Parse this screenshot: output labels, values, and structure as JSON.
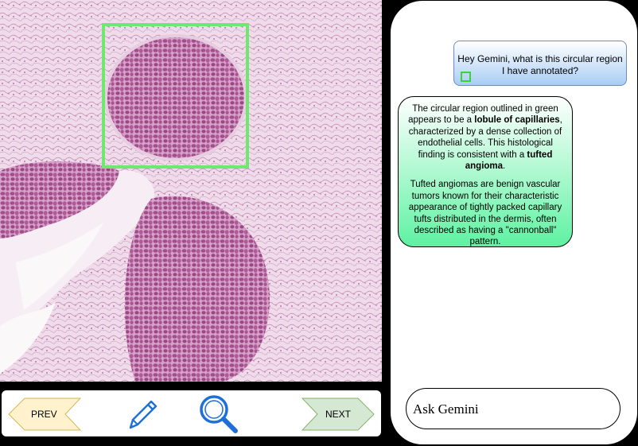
{
  "viewer": {
    "tissue": "histology-slide"
  },
  "toolbar": {
    "prev_label": "PREV",
    "next_label": "NEXT",
    "pen_icon": "pen-icon",
    "search_icon": "magnifier-icon"
  },
  "chat": {
    "user_message": "Hey Gemini, what is this circular region I have annotated?",
    "ai_p1_a": "The circular region outlined in green appears to be a ",
    "ai_p1_b": "lobule of capillaries",
    "ai_p1_c": ", characterized by a dense collection of endothelial cells. This histological finding is consistent with a ",
    "ai_p1_d": "tufted angioma",
    "ai_p1_e": ".",
    "ai_p2": "Tufted angiomas are benign vascular tumors known for their characteristic appearance of tightly packed capillary tufts distributed in the dermis, often described as having a \"cannonball\" pattern.",
    "input_placeholder": "Ask Gemini"
  },
  "colors": {
    "annotation": "#6ee86e",
    "prev_fill": "#fff2cc",
    "prev_stroke": "#d6b656",
    "next_fill": "#d5e8d4",
    "next_stroke": "#82b366",
    "icon_blue": "#1e6fd9"
  }
}
